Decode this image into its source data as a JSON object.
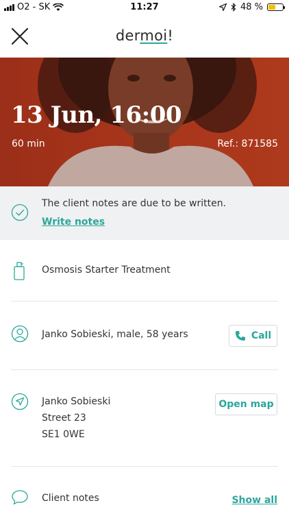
{
  "status_bar": {
    "carrier": "O2 - SK",
    "time": "11:27",
    "battery_percent_label": "48 %",
    "battery_level": 0.48
  },
  "header": {
    "logo": {
      "part1": "der",
      "part2": "moi",
      "part3": "!"
    },
    "close_icon": "close-icon"
  },
  "appointment": {
    "date_time": "13 Jun, 16:00",
    "duration": "60 min",
    "reference": "Ref.: 871585"
  },
  "notes_banner": {
    "message": "The client notes are due to be written.",
    "action_label": "Write notes"
  },
  "treatment": {
    "name": "Osmosis Starter Treatment"
  },
  "client": {
    "summary": "Janko Sobieski, male, 58 years",
    "call_label": "Call"
  },
  "address": {
    "lines": [
      "Janko Sobieski",
      "Street 23",
      "SE1 0WE"
    ],
    "map_label": "Open map"
  },
  "client_notes": {
    "label": "Client notes",
    "show_all_label": "Show all"
  },
  "colors": {
    "accent": "#2aa79b",
    "hero": "#b93d1f",
    "banner_bg": "#f0f1f2",
    "battery": "#f2c200"
  }
}
